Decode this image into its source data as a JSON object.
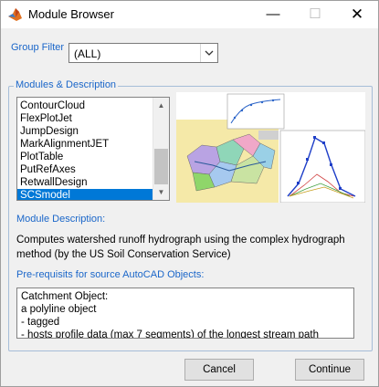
{
  "window": {
    "title": "Module Browser",
    "minimize_glyph": "—",
    "maximize_glyph": "☐",
    "close_glyph": "✕"
  },
  "group_filter": {
    "label": "Group Filter",
    "value": "(ALL)"
  },
  "modules_group": {
    "title": "Modules & Description",
    "items": [
      "ContourCloud",
      "FlexPlotJet",
      "JumpDesign",
      "MarkAlignmentJET",
      "PlotTable",
      "PutRefAxes",
      "RetwallDesign",
      "SCSmodel"
    ],
    "selected": "SCSmodel"
  },
  "module_description": {
    "label": "Module Description:",
    "text": "Computes watershed runoff hydrograph using the complex hydrograph method (by the US Soil Conservation Service)"
  },
  "prerequisites": {
    "label": "Pre-requisits for source AutoCAD Objects:",
    "lines": [
      "Catchment Object:",
      " a polyline object",
      "- tagged",
      "- hosts profile data (max 7 segments) of the longest stream path"
    ]
  },
  "buttons": {
    "cancel": "Cancel",
    "continue": "Continue"
  },
  "colors": {
    "accent": "#1a66c9",
    "selection": "#0078d7"
  }
}
